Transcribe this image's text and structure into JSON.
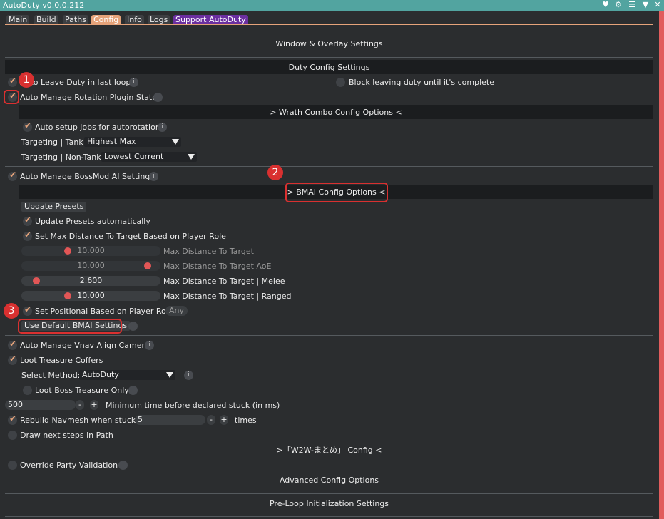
{
  "window": {
    "title": "AutoDuty v0.0.0.212"
  },
  "titlebar_icons": [
    "heart-icon",
    "gear-icon",
    "menu-icon",
    "collapse-icon",
    "close-icon"
  ],
  "tabs": [
    {
      "label": "Main"
    },
    {
      "label": "Build"
    },
    {
      "label": "Paths"
    },
    {
      "label": "Config"
    },
    {
      "label": "Info"
    },
    {
      "label": "Logs"
    },
    {
      "label": "Support AutoDuty"
    }
  ],
  "sections": {
    "window_overlay": "Window & Overlay Settings",
    "duty_config": "Duty Config Settings",
    "wrath": "> Wrath Combo Config Options <",
    "bmai": "> BMAI Config Options <",
    "w2w": ">「W2W-まとめ」 Config <",
    "advanced": "Advanced Config Options",
    "preloop": "Pre-Loop Initialization Settings"
  },
  "options": {
    "auto_leave": "Auto Leave Duty in last loop",
    "block_leaving": "Block leaving duty until it's complete",
    "auto_manage_rotation": "Auto Manage Rotation Plugin State",
    "auto_setup_jobs": "Auto setup jobs for autorotation",
    "targeting_tank_label": "Targeting | Tank:",
    "targeting_tank_value": "Highest Max",
    "targeting_nontank_label": "Targeting | Non-Tank:",
    "targeting_nontank_value": "Lowest Current",
    "auto_manage_bossmod": "Auto Manage BossMod AI Settings",
    "update_presets_button": "Update Presets",
    "update_presets_auto": "Update Presets automatically",
    "set_max_distance": "Set Max Distance To Target Based on Player Role",
    "set_positional": "Set Positional Based on Player Role",
    "positional_value": "Any",
    "use_default_bmai": "Use Default BMAI Settings",
    "vnav_align": "Auto Manage Vnav Align Camera",
    "loot_treasure": "Loot Treasure Coffers",
    "select_method_label": "Select Method:",
    "select_method_value": "AutoDuty",
    "loot_boss_only": "Loot Boss Treasure Only",
    "stuck_time_value": "500",
    "stuck_time_label": "Minimum time before declared stuck (in ms)",
    "rebuild_navmesh": "Rebuild Navmesh when stuck",
    "rebuild_times_value": "5",
    "rebuild_times_label": "times",
    "draw_next_steps": "Draw next steps in Path",
    "override_party": "Override Party Validation"
  },
  "sliders": [
    {
      "value": "10.000",
      "label": "Max Distance To Target",
      "level": 0.32,
      "disabled": true
    },
    {
      "value": "10.000",
      "label": "Max Distance To Target AoE",
      "level": 0.94,
      "disabled": true
    },
    {
      "value": "2.600",
      "label": "Max Distance To Target | Melee",
      "level": 0.08,
      "disabled": false
    },
    {
      "value": "10.000",
      "label": "Max Distance To Target | Ranged",
      "level": 0.32,
      "disabled": false
    }
  ],
  "stepper": {
    "minus": "-",
    "plus": "+"
  },
  "info_glyph": "i",
  "annotations": [
    "1",
    "2",
    "3"
  ],
  "colors": {
    "accent": "#e6a37a",
    "titlebar": "#52a4a0",
    "support_tab": "#6b2fa0",
    "slider_knob": "#e25656",
    "annotation": "#d93030"
  }
}
